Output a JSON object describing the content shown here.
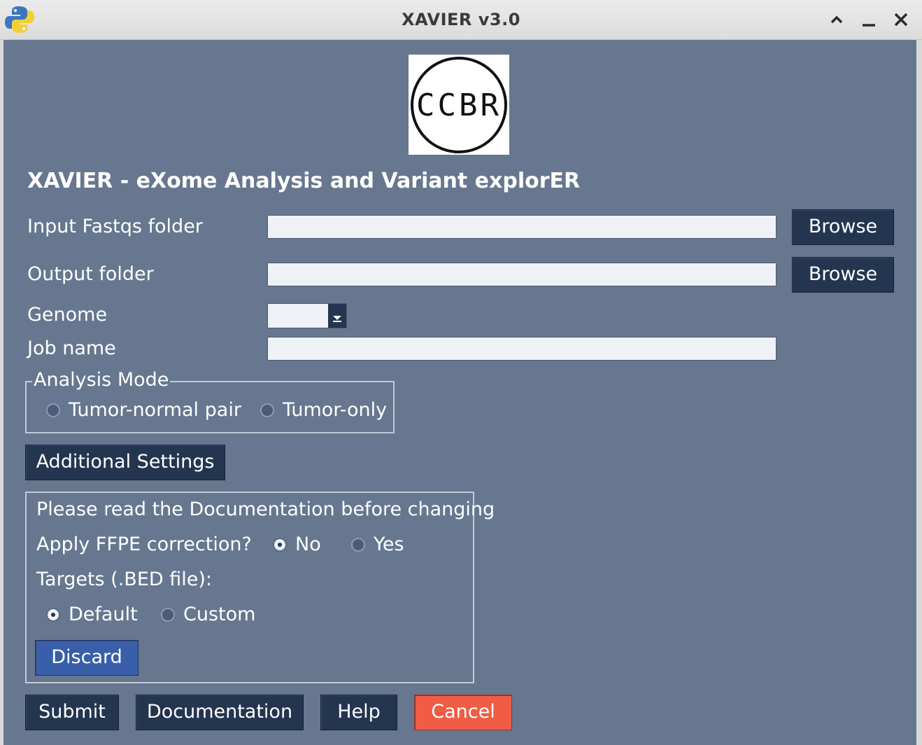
{
  "window": {
    "title": "XAVIER v3.0"
  },
  "logo": {
    "text": "CCBR"
  },
  "heading": "XAVIER - eXome Analysis and Variant explorER",
  "form": {
    "input_fastqs_label": "Input Fastqs folder",
    "input_fastqs_value": "",
    "output_folder_label": "Output folder",
    "output_folder_value": "",
    "browse_label": "Browse",
    "genome_label": "Genome",
    "genome_selected": "",
    "job_name_label": "Job name",
    "job_name_value": ""
  },
  "analysis_mode": {
    "legend": "Analysis Mode",
    "options": [
      {
        "label": "Tumor-normal pair",
        "checked": false
      },
      {
        "label": "Tumor-only",
        "checked": false
      }
    ]
  },
  "additional_settings": {
    "button_label": "Additional Settings",
    "note": "Please read the Documentation before changing",
    "ffpe_label": "Apply FFPE correction?",
    "ffpe_options": [
      {
        "label": "No",
        "checked": true
      },
      {
        "label": "Yes",
        "checked": false
      }
    ],
    "targets_label": "Targets (.BED file):",
    "targets_options": [
      {
        "label": "Default",
        "checked": true
      },
      {
        "label": "Custom",
        "checked": false
      }
    ],
    "discard_label": "Discard"
  },
  "actions": {
    "submit": "Submit",
    "documentation": "Documentation",
    "help": "Help",
    "cancel": "Cancel"
  },
  "colors": {
    "panel_bg": "#66778f",
    "button_bg": "#243550",
    "discard_bg": "#3a5faa",
    "cancel_bg": "#f05c44"
  }
}
